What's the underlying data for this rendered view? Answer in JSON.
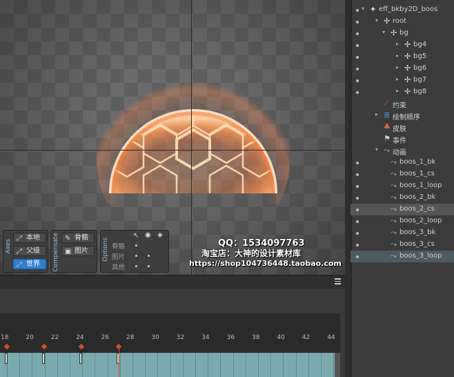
{
  "axes_toolbar": {
    "title": "Axes",
    "buttons": [
      "本地",
      "父级",
      "世界"
    ],
    "active_index": 2
  },
  "compensate_toolbar": {
    "title": "Compensate",
    "buttons": [
      "骨骼",
      "图片"
    ]
  },
  "options_toolbar": {
    "title": "Options",
    "rows": [
      "骨骼",
      "图片",
      "其他"
    ]
  },
  "watermark": {
    "line1": "QQ：1534097763",
    "line2": "淘宝店：大神的设计素材库",
    "line3": "https://shop104736448.taobao.com"
  },
  "timeline": {
    "ticks": [
      "18",
      "20",
      "22",
      "24",
      "26",
      "28",
      "30",
      "32",
      "34",
      "36",
      "38",
      "40",
      "42",
      "44"
    ]
  },
  "colors": {
    "accent": "#2d7fd1",
    "keyframe": "#d94a2a",
    "track": "#7aaab0",
    "glow": "#ff8a4a"
  },
  "tree": {
    "items": [
      {
        "label": "eff_bkby2D_boos",
        "icon": "skeleton-icon"
      },
      {
        "label": "root",
        "icon": "bone-icon"
      },
      {
        "label": "bg",
        "icon": "bone-icon"
      },
      {
        "label": "bg4",
        "icon": "bone-icon"
      },
      {
        "label": "bg5",
        "icon": "bone-icon"
      },
      {
        "label": "bg6",
        "icon": "bone-icon"
      },
      {
        "label": "bg7",
        "icon": "bone-icon"
      },
      {
        "label": "bg8",
        "icon": "bone-icon"
      },
      {
        "label": "约束",
        "icon": "constraint-icon"
      },
      {
        "label": "绘制顺序",
        "icon": "draw-order-icon"
      },
      {
        "label": "皮肤",
        "icon": "skin-icon"
      },
      {
        "label": "事件",
        "icon": "event-icon"
      },
      {
        "label": "动画",
        "icon": "animation-icon"
      },
      {
        "label": "boos_1_bk",
        "icon": "animation-icon"
      },
      {
        "label": "boos_1_cs",
        "icon": "animation-icon"
      },
      {
        "label": "boos_1_loop",
        "icon": "animation-icon"
      },
      {
        "label": "boos_2_bk",
        "icon": "animation-icon"
      },
      {
        "label": "boos_2_cs",
        "icon": "animation-icon"
      },
      {
        "label": "boos_2_loop",
        "icon": "animation-icon"
      },
      {
        "label": "boos_3_bk",
        "icon": "animation-icon"
      },
      {
        "label": "boos_3_cs",
        "icon": "animation-icon"
      },
      {
        "label": "boos_3_loop",
        "icon": "animation-icon"
      }
    ]
  }
}
